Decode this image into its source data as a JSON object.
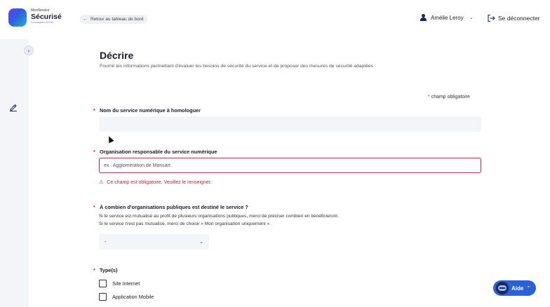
{
  "brand": {
    "small": "MonService",
    "name": "Sécurisé",
    "tagline": "homologation ANSSI"
  },
  "header": {
    "back_label": "Retour au tableau de bord",
    "user_name": "Amélie Leroy",
    "logout_label": "Se déconnecter"
  },
  "page": {
    "title": "Décrire",
    "subtitle": "Fournir les informations permettant d'évaluer les besoins de sécurité du service et de proposer des mesures de sécurité adaptées",
    "required_note": "champ obligatoire",
    "required_marker": "*"
  },
  "form": {
    "service_name": {
      "label": "Nom du service numérique à homologuer",
      "value": ""
    },
    "organisation": {
      "label": "Organisation responsable du service numérique",
      "placeholder": "ex : Agglomération de Mansart",
      "error": "Ce champ est obligatoire. Veuillez le renseigner."
    },
    "public_orgs": {
      "label": "À combien d'organisations publiques est destiné le service ?",
      "help_1": "Si le service est mutualisé au profit de plusieurs organisations publiques, merci de préciser combien en bénéficieront.",
      "help_2": "Si le service n'est pas mutualisé, merci de choisir « Mon organisation uniquement ».",
      "selected": "-"
    },
    "types": {
      "label": "Type(s)",
      "options": [
        "Site Internet",
        "Application Mobile"
      ]
    }
  },
  "help_widget": {
    "label": "Aide"
  },
  "colors": {
    "accent": "#2a62d6",
    "error": "#c8203c",
    "sidebar": "#f4f5f9"
  },
  "icons": [
    "back-arrow-icon",
    "user-icon",
    "chevron-down-icon",
    "logout-icon",
    "chevron-right-icon",
    "pencil-icon",
    "warning-icon",
    "robot-icon",
    "chevron-up-icon"
  ]
}
